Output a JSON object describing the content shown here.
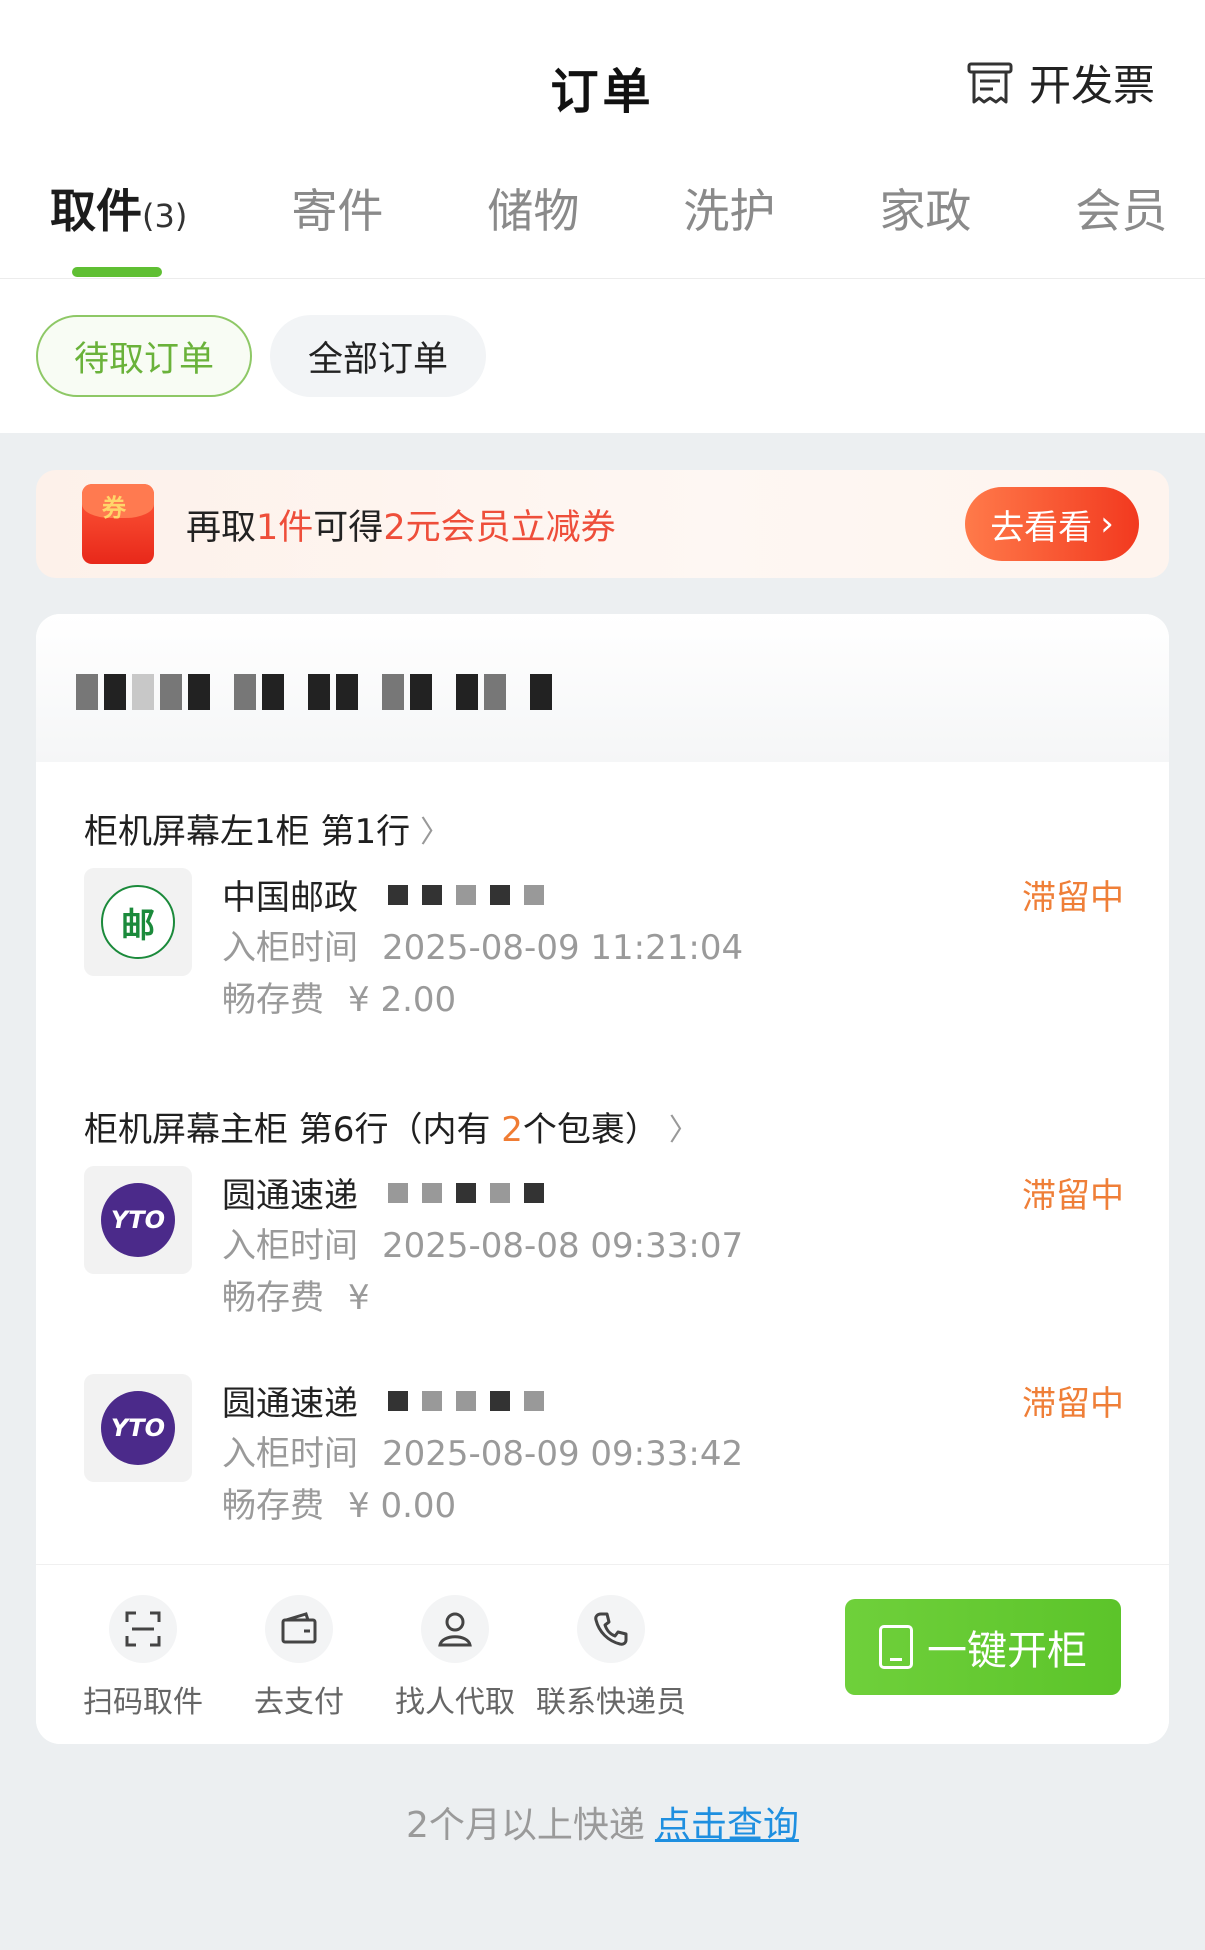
{
  "header": {
    "title": "订单",
    "invoice_label": "开发票"
  },
  "tabs": [
    {
      "label": "取件",
      "count": "(3)"
    },
    {
      "label": "寄件"
    },
    {
      "label": "储物"
    },
    {
      "label": "洗护"
    },
    {
      "label": "家政"
    },
    {
      "label": "会员"
    }
  ],
  "filters": {
    "pending": "待取订单",
    "all": "全部订单"
  },
  "promo": {
    "icon_text": "券",
    "pre": "再取",
    "count": "1件",
    "mid": "可得",
    "reward": "2元会员立减券",
    "button": "去看看"
  },
  "groups": [
    {
      "location": "柜机屏幕左1柜 第1行",
      "packages": [
        {
          "carrier": "中国邮政",
          "logo": "ems-logo",
          "time_label": "入柜时间",
          "time": "2025-08-09 11:21:04",
          "fee_label": "畅存费",
          "fee": "¥ 2.00",
          "status": "滞留中"
        }
      ]
    },
    {
      "location_pre": "柜机屏幕主柜 第6行（内有 ",
      "location_count": "2",
      "location_post": "个包裹）",
      "packages": [
        {
          "carrier": "圆通速递",
          "logo": "yto-logo",
          "time_label": "入柜时间",
          "time": "2025-08-08 09:33:07",
          "fee_label": "畅存费",
          "fee": "¥",
          "status": "滞留中"
        },
        {
          "carrier": "圆通速递",
          "logo": "yto-logo",
          "time_label": "入柜时间",
          "time": "2025-08-09 09:33:42",
          "fee_label": "畅存费",
          "fee": "¥ 0.00",
          "status": "滞留中"
        }
      ]
    }
  ],
  "actions": {
    "scan": "扫码取件",
    "pay": "去支付",
    "proxy": "找人代取",
    "courier": "联系快递员",
    "open": "一键开柜"
  },
  "footer": {
    "text": "2个月以上快递",
    "link": "点击查询"
  },
  "colors": {
    "accent_green": "#5fbf33",
    "status_orange": "#ef7f38",
    "promo_red": "#ee4e3a",
    "link_blue": "#1e8fe0"
  }
}
